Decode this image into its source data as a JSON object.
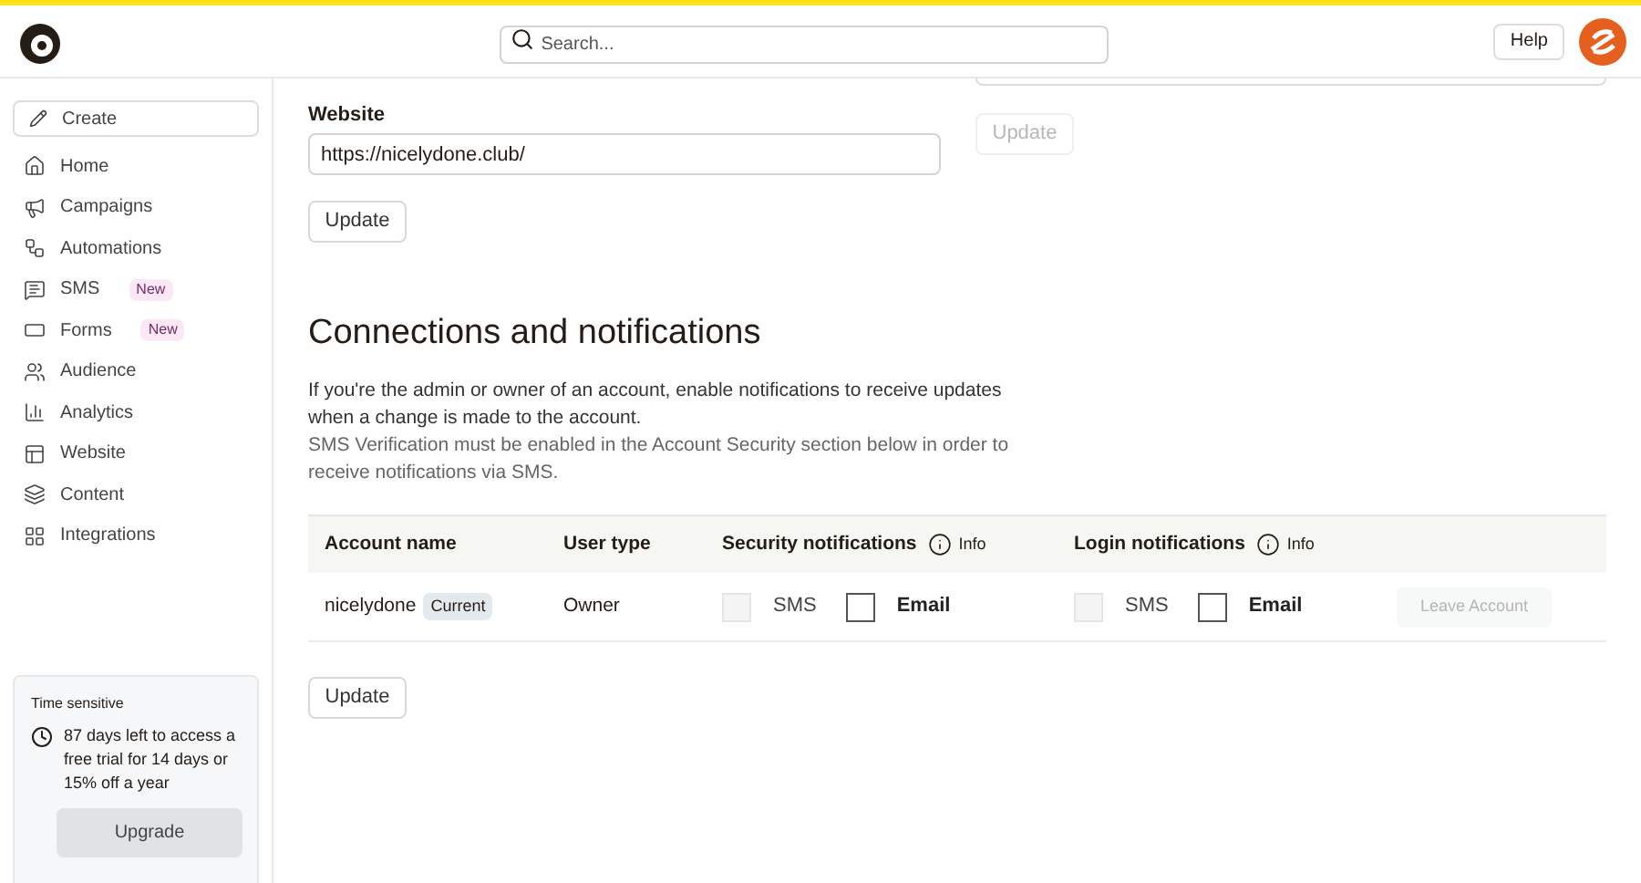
{
  "header": {
    "search": {
      "placeholder": "Search..."
    },
    "help_button": "Help"
  },
  "sidebar": {
    "create_button": "Create",
    "items": [
      {
        "label": "Home"
      },
      {
        "label": "Campaigns"
      },
      {
        "label": "Automations"
      },
      {
        "label": "SMS",
        "badge": "New"
      },
      {
        "label": "Forms",
        "badge": "New"
      },
      {
        "label": "Audience"
      },
      {
        "label": "Analytics"
      },
      {
        "label": "Website"
      },
      {
        "label": "Content"
      },
      {
        "label": "Integrations"
      }
    ],
    "trial_card": {
      "heading": "Time sensitive",
      "message": "87 days left to access a free trial for 14 days or 15% off a year",
      "button": "Upgrade"
    }
  },
  "top_right": {
    "update_button": {
      "label": "Update",
      "disabled": true
    }
  },
  "website": {
    "label": "Website",
    "value": "https://nicelydone.club/",
    "update_button": {
      "label": "Update",
      "disabled": false
    }
  },
  "connections": {
    "title": "Connections and notifications",
    "description": "If you're the admin or owner of an account, enable notifications to receive updates when a change is made to the account.",
    "note": "SMS Verification must be enabled in the Account Security section below in order to receive notifications via SMS.",
    "table": {
      "columns": [
        {
          "label": "Account name"
        },
        {
          "label": "User type"
        },
        {
          "label": "Security notifications",
          "info": "Info"
        },
        {
          "label": "Login notifications",
          "info": "Info"
        }
      ],
      "rows": [
        {
          "account": "nicelydone",
          "badge": "Current",
          "user_type": "Owner",
          "security": [
            {
              "label": "SMS",
              "checked": false,
              "disabled": true
            },
            {
              "label": "Email",
              "checked": false,
              "disabled": false
            }
          ],
          "login": [
            {
              "label": "SMS",
              "checked": false,
              "disabled": true
            },
            {
              "label": "Email",
              "checked": false,
              "disabled": false
            }
          ],
          "leave_button": {
            "label": "Leave Account",
            "disabled": true
          }
        }
      ]
    },
    "update_button": {
      "label": "Update",
      "disabled": false
    }
  }
}
